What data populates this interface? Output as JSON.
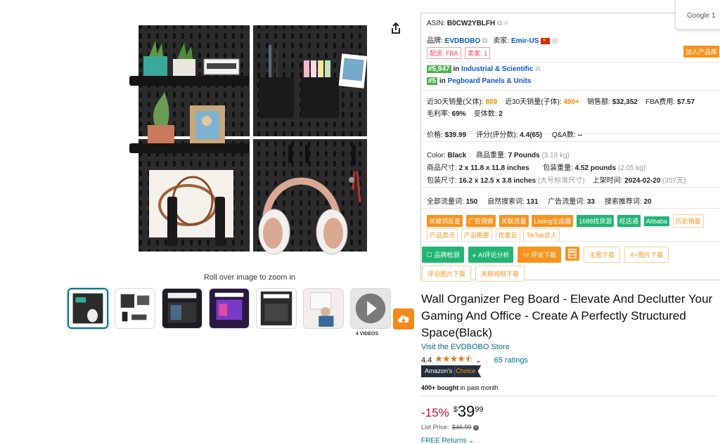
{
  "image": {
    "zoom_hint": "Roll over image to zoom in",
    "video_label": "4 VIDEOS",
    "thumbnail_count": 7
  },
  "panel": {
    "asin_label": "ASIN:",
    "asin": "B0CW2YBLFH",
    "brand_label": "品牌:",
    "brand": "EVDBOBO",
    "seller_label": "卖家:",
    "seller": "Emir-US",
    "fulfillment_tag": "配送: FBA",
    "sellers_tag": "卖家: 1",
    "add_library": "加入产品库",
    "rank1": "#5,947",
    "rank1_in": "in",
    "rank1_cat": "Industrial & Scientific",
    "rank2": "#5",
    "rank2_in": "in",
    "rank2_cat": "Pegboard Panels & Units",
    "sales30_parent_label": "近30天销量(父体):",
    "sales30_parent": "809",
    "sales30_child_label": "近30天销量(子体):",
    "sales30_child": "400+",
    "revenue_label": "销售额:",
    "revenue": "$32,352",
    "fba_label": "FBA费用:",
    "fba": "$7.57",
    "margin_label": "毛利率:",
    "margin": "69%",
    "variants_label": "变体数:",
    "variants": "2",
    "price_label": "价格:",
    "price": "$39.99",
    "score_label": "评分(评分数):",
    "score": "4.4(65)",
    "qa_label": "Q&A数:",
    "qa": "--",
    "color_label": "Color:",
    "color": "Black",
    "weight_label": "商品重量:",
    "weight": "7 Pounds",
    "weight_kg": "(3.18 kg)",
    "size_label": "商品尺寸:",
    "size": "2 x 11.8 x 11.8 inches",
    "pkg_weight_label": "包装重量:",
    "pkg_weight": "4.52 pounds",
    "pkg_weight_kg": "(2.05 kg)",
    "pkg_size_label": "包装尺寸:",
    "pkg_size": "16.2 x 12.5 x 3.8 inches",
    "pkg_size_note": "(大号标准尺寸)",
    "launch_label": "上架时间:",
    "launch": "2024-02-20",
    "launch_days": "(357天)",
    "kw_total_label": "全部流量词:",
    "kw_total": "150",
    "kw_organic_label": "自然搜索词:",
    "kw_organic": "131",
    "kw_ads_label": "广告流量词:",
    "kw_ads": "33",
    "kw_rec_label": "搜索推荐词:",
    "kw_rec": "20",
    "chips_row1": [
      "关键词反查",
      "广告洞察",
      "关联流量",
      "Listing生成器",
      "1688找货源",
      "旺店通",
      "Alibaba",
      "历史销量"
    ],
    "chips_row2": [
      "产品卖点",
      "产品概要",
      "优麦云",
      "TikTok达人"
    ],
    "btn_brand": "品牌检测",
    "btn_ai": "AI评论分析",
    "btn_review_dl": "评论下载",
    "btn_main_img": "主图下载",
    "btn_aplus": "A+图片下载",
    "btn_review_img": "评论图片下载",
    "btn_video": "关联视频下载"
  },
  "google_tab": "Google 1",
  "product": {
    "title": "Wall Organizer Peg Board - Elevate And Declutter Your Gaming And Office - Create A Perfectly Structured Space(Black)",
    "store": "Visit the EVDBOBO Store",
    "rating_value": "4.4",
    "rating_count": "65 ratings",
    "choice_a": "Amazon's",
    "choice_b": "Choice",
    "bought_bold": "400+ bought",
    "bought_rest": "in past month",
    "discount": "-15%",
    "currency": "$",
    "price_whole": "39",
    "price_fraction": "99",
    "list_price_label": "List Price:",
    "list_price": "$46.99",
    "returns": "FREE Returns"
  },
  "colors": {
    "accent_orange": "#f7931e",
    "green": "#21b573",
    "link": "#007185",
    "deal_red": "#cc0c39"
  }
}
